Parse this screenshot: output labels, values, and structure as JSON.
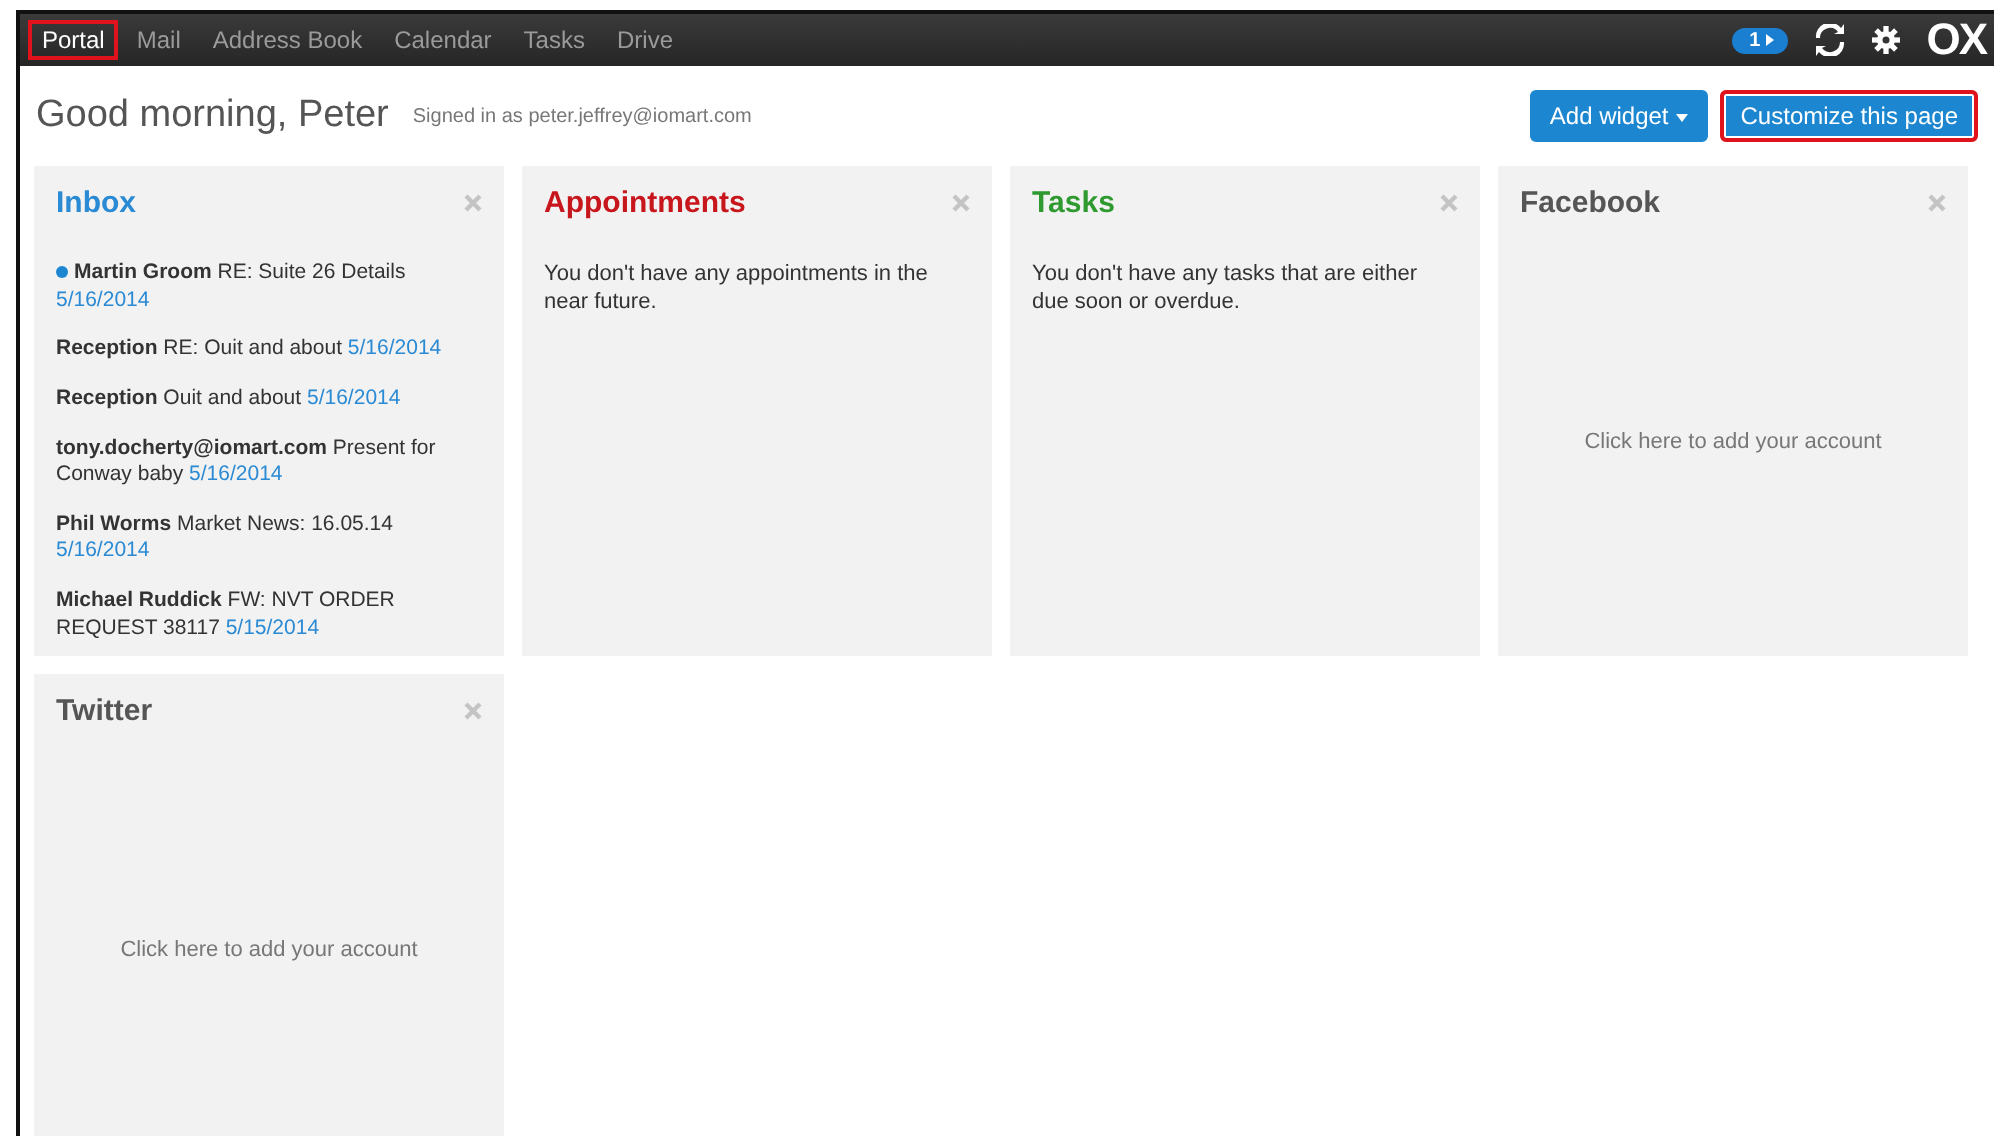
{
  "nav": {
    "tabs": [
      {
        "label": "Portal",
        "selected": true,
        "highlighted": true
      },
      {
        "label": "Mail",
        "selected": false,
        "highlighted": false
      },
      {
        "label": "Address Book",
        "selected": false,
        "highlighted": false
      },
      {
        "label": "Calendar",
        "selected": false,
        "highlighted": false
      },
      {
        "label": "Tasks",
        "selected": false,
        "highlighted": false
      },
      {
        "label": "Drive",
        "selected": false,
        "highlighted": false
      }
    ],
    "badge": "1",
    "logo": "OX"
  },
  "header": {
    "greeting": "Good morning, Peter",
    "signed_in": "Signed in as peter.jeffrey@iomart.com",
    "buttons": [
      {
        "label": "Add widget",
        "kind": "dropdown",
        "highlighted": false
      },
      {
        "label": "Customize this page",
        "kind": "plain",
        "highlighted": true
      }
    ]
  },
  "widgets": [
    {
      "title": "Inbox",
      "color": "#2a8ad4",
      "kind": "mail",
      "items": [
        {
          "sender": "Martin Groom",
          "subject": "RE: Suite 26 Details",
          "date": "5/16/2014",
          "unread": true
        },
        {
          "sender": "Reception",
          "subject": "RE: Ouit and about",
          "date": "5/16/2014",
          "unread": false
        },
        {
          "sender": "Reception",
          "subject": "Ouit and about",
          "date": "5/16/2014",
          "unread": false
        },
        {
          "sender": "tony.docherty@iomart.com",
          "subject": "Present for Conway baby",
          "date": "5/16/2014",
          "unread": false
        },
        {
          "sender": "Phil Worms",
          "subject": "Market News: 16.05.14",
          "date": "5/16/2014",
          "unread": false
        },
        {
          "sender": "Michael Ruddick",
          "subject": "FW: NVT ORDER REQUEST 38117",
          "date": "5/15/2014",
          "unread": false
        }
      ]
    },
    {
      "title": "Appointments",
      "color": "#c8161d",
      "kind": "message",
      "text": "You don't have any appointments in the near future."
    },
    {
      "title": "Tasks",
      "color": "#2f9a2f",
      "kind": "message",
      "text": "You don't have any tasks that are either due soon or overdue."
    },
    {
      "title": "Facebook",
      "color": "#555555",
      "kind": "account",
      "text": "Click here to add your account"
    },
    {
      "title": "Twitter",
      "color": "#555555",
      "kind": "account",
      "text": "Click here to add your account"
    }
  ]
}
